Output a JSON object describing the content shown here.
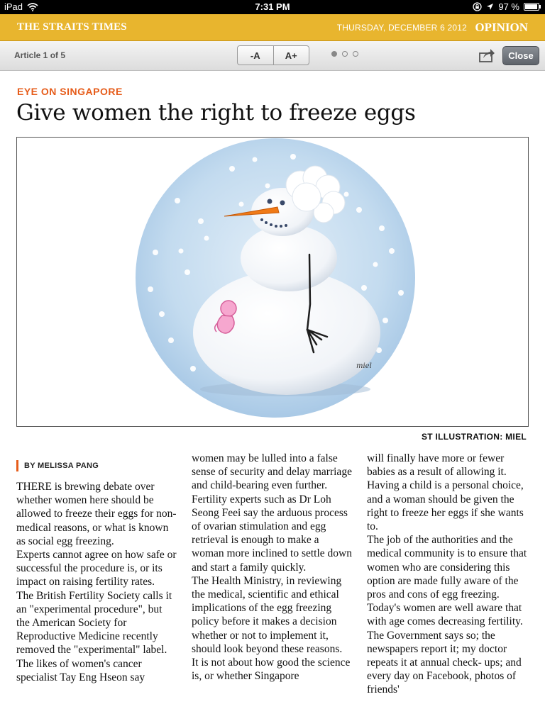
{
  "status_bar": {
    "device": "iPad",
    "time": "7:31 PM",
    "battery": "97 %",
    "battery_level": 0.97
  },
  "masthead": {
    "brand": "THE STRAITS TIMES",
    "date": "THURSDAY, DECEMBER 6 2012",
    "section": "OPINION"
  },
  "toolbar": {
    "counter": "Article 1 of 5",
    "font_decrease": "-A",
    "font_increase": "A+",
    "page_dots": 3,
    "active_dot": 1,
    "close": "Close"
  },
  "article": {
    "kicker": "EYE ON SINGAPORE",
    "headline": "Give women the right to freeze eggs",
    "caption": "ST ILLUSTRATION: MIEL",
    "signature": "miel",
    "byline": "BY MELISSA PANG",
    "columns": [
      [
        "THERE is brewing debate over whether women here should be allowed to freeze their eggs for non-medical reasons, or what is known as social egg freezing.",
        " Experts cannot agree on how safe or successful the procedure is, or its impact on raising fertility rates.",
        " The British Fertility Society calls it an \"experimental procedure\", but the American Society for Reproductive Medicine recently removed the \"experimental\" label.",
        " The likes of women's cancer specialist Tay Eng Hseon say"
      ],
      [
        "women may be lulled into a false sense of security and delay marriage and child-bearing even further. Fertility experts such as Dr Loh Seong Feei say the arduous process of ovarian stimulation and egg retrieval is enough to make a woman more inclined to settle down and start a family quickly.",
        " The Health Ministry, in reviewing the medical, scientific and ethical implications of the egg freezing policy before it makes a decision whether or not to implement it, should look beyond these reasons.",
        " It is not about how good the science is, or whether Singapore"
      ],
      [
        "will finally have more or fewer babies as a result of allowing it.",
        " Having a child is a personal choice, and a woman should be given the right to freeze her eggs if she wants to.",
        " The job of the authorities and the medical community is to ensure that women who are considering this option are made fully aware of the pros and cons of egg freezing.",
        " Today's women are well aware that with age comes decreasing fertility. The Government says so; the newspapers report it; my doctor repeats it at annual check- ups; and every day on Facebook, photos of friends'"
      ]
    ]
  },
  "icons": [
    "wifi-icon",
    "lock-rotation-icon",
    "location-arrow-icon",
    "battery-icon",
    "share-icon"
  ],
  "colors": {
    "masthead": "#e8b52e",
    "kicker": "#e65c1a",
    "illustration_circle": "#bcd6ec"
  }
}
